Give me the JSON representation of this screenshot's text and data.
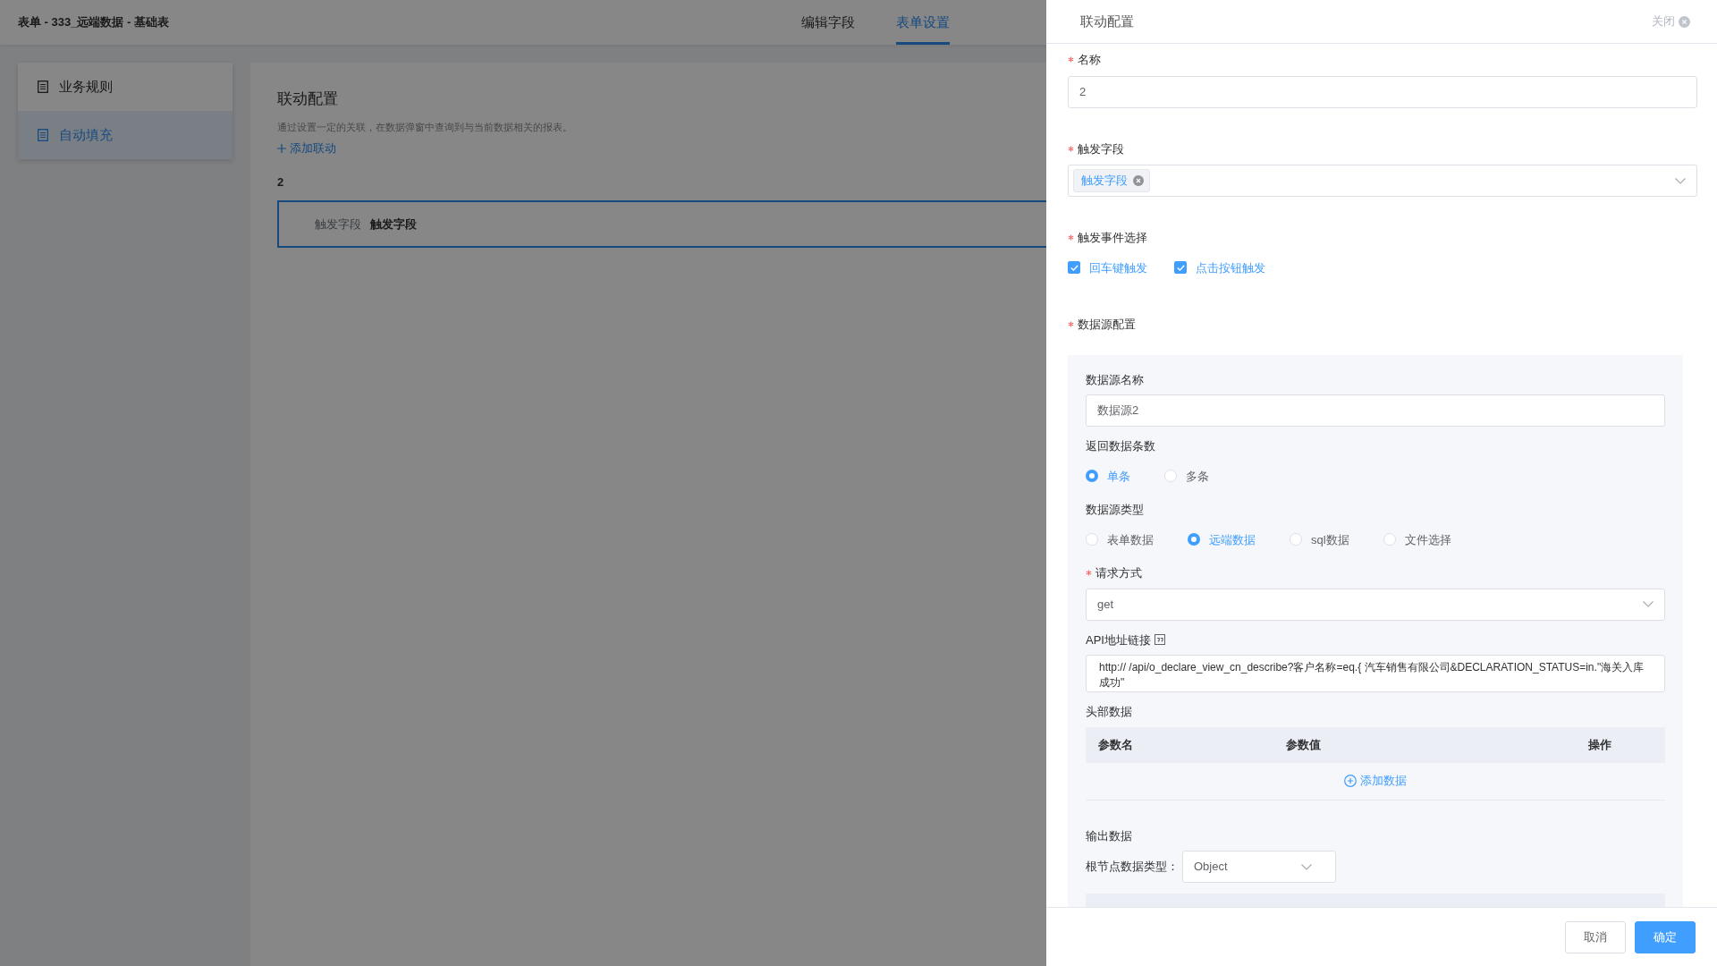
{
  "page": {
    "title": "表单 - 333_远端数据 - 基础表",
    "tabs": [
      {
        "label": "编辑字段",
        "selected": false
      },
      {
        "label": "表单设置",
        "selected": true
      }
    ],
    "sidebar": {
      "items": [
        {
          "label": "业务规则",
          "selected": false
        },
        {
          "label": "自动填充",
          "selected": true
        }
      ]
    },
    "main": {
      "title": "联动配置",
      "description": "通过设置一定的关联，在数据弹窗中查询到与当前数据相关的报表。",
      "add_link": "添加联动",
      "linkage": {
        "name": "2",
        "field_label": "触发字段",
        "field_value": "触发字段"
      }
    }
  },
  "drawer": {
    "title": "联动配置",
    "close": "关闭",
    "name": {
      "label": "名称",
      "required": true,
      "value": "2"
    },
    "trigger_field": {
      "label": "触发字段",
      "required": true,
      "tags": [
        "触发字段"
      ]
    },
    "trigger_events": {
      "label": "触发事件选择",
      "required": true,
      "options": [
        {
          "label": "回车键触发",
          "checked": true
        },
        {
          "label": "点击按钮触发",
          "checked": true
        }
      ]
    },
    "datasource": {
      "label": "数据源配置",
      "required": true,
      "name": {
        "label": "数据源名称",
        "value": "数据源2"
      },
      "count": {
        "label": "返回数据条数",
        "options": [
          {
            "label": "单条",
            "selected": true
          },
          {
            "label": "多条",
            "selected": false
          }
        ]
      },
      "type": {
        "label": "数据源类型",
        "options": [
          {
            "label": "表单数据",
            "selected": false
          },
          {
            "label": "远端数据",
            "selected": true
          },
          {
            "label": "sql数据",
            "selected": false
          },
          {
            "label": "文件选择",
            "selected": false
          }
        ]
      },
      "method": {
        "label": "请求方式",
        "required": true,
        "value": "get"
      },
      "api": {
        "label": "API地址链接",
        "value": "http:// /api/o_declare_view_cn_describe?客户名称=eq.{ 汽车销售有限公司&DECLARATION_STATUS=in.\"海关入库成功\""
      },
      "headers": {
        "label": "头部数据",
        "columns": [
          "参数名",
          "参数值",
          "操作"
        ],
        "add": "添加数据"
      },
      "output": {
        "label": "输出数据",
        "root_label": "根节点数据类型：",
        "root_value": "Object"
      }
    },
    "buttons": [
      {
        "label": "取消",
        "kind": "default"
      },
      {
        "label": "确定",
        "kind": "primary"
      }
    ]
  }
}
